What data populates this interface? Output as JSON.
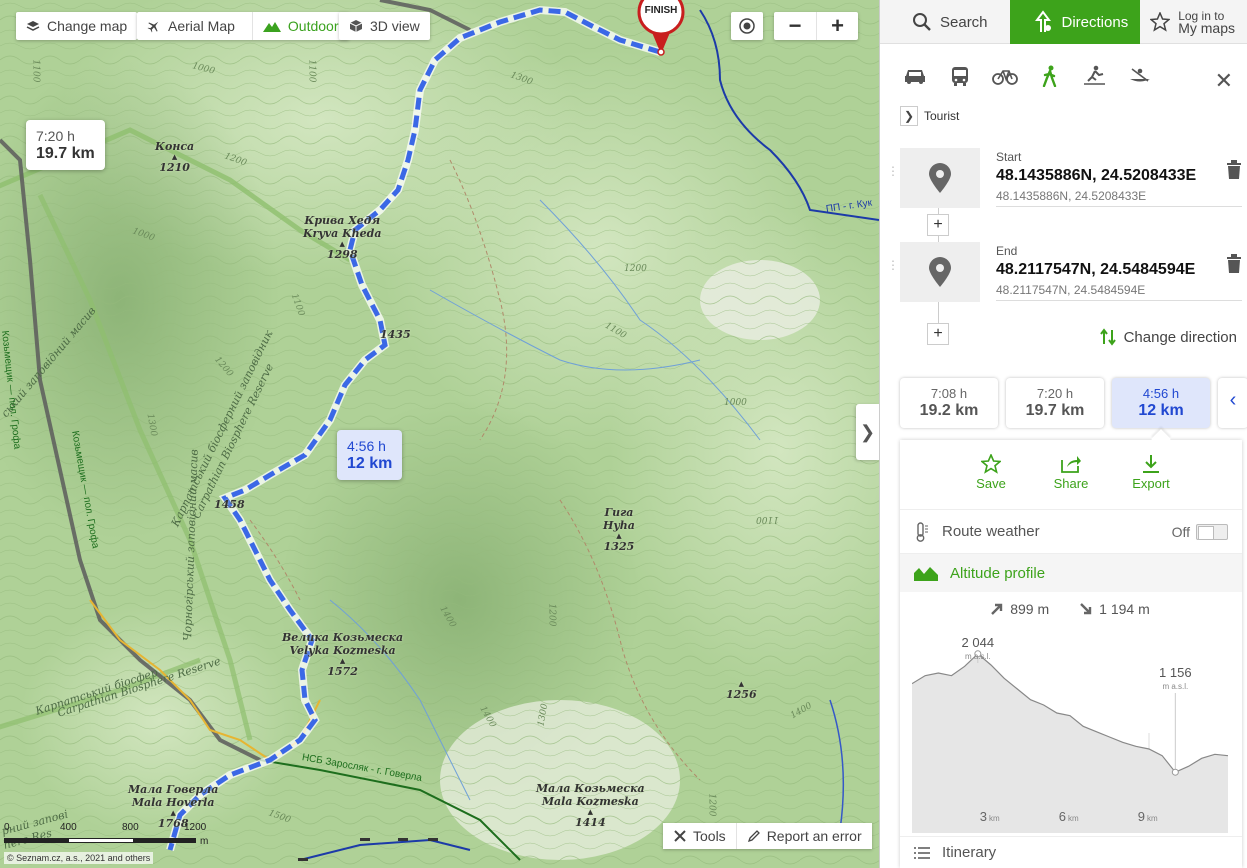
{
  "map_controls": {
    "change_map": "Change map",
    "aerial_map": "Aerial Map",
    "outdoor": "Outdoor",
    "view3d": "3D view",
    "zoom_out": "−",
    "zoom_in": "+",
    "tools": "Tools",
    "report_error": "Report an error"
  },
  "map": {
    "finish_label": "FINISH",
    "bubbles": [
      {
        "time": "7:20 h",
        "distance": "19.7 km"
      },
      {
        "time": "4:56 h",
        "distance": "12 km"
      }
    ],
    "peaks": [
      {
        "name": "Конса",
        "elev": "1210"
      },
      {
        "name": "Крива Хедя",
        "name2": "Kryva Kheda",
        "elev": "1298"
      },
      {
        "name": "Гига",
        "name2": "Hyha",
        "elev": "1325"
      },
      {
        "name": "Велика Козьмеска",
        "name2": "Velyka Kozmeska",
        "elev": "1572"
      },
      {
        "name": "Мала Говерла",
        "name2": "Mala Hoverla",
        "elev": "1768"
      },
      {
        "name": "Мала Козьмеска",
        "name2": "Mala Kozmeska",
        "elev": "1414"
      },
      {
        "elev": "1256"
      },
      {
        "elev": "1435"
      },
      {
        "elev": "1458"
      }
    ],
    "contours": [
      "1100",
      "1000",
      "1300",
      "1200",
      "1000",
      "1100",
      "1200",
      "1200",
      "1300",
      "1000",
      "1100",
      "1100",
      "1200",
      "1400",
      "1300",
      "1200",
      "1400",
      "1100",
      "1500",
      "1400"
    ],
    "roads": {
      "road1": "ПП - г. Кук",
      "road2": "НСБ Заросляк - г. Говерла",
      "trail1": "Козьмещик — пол. Грофа",
      "trail2": "Козьмещик — пол. Грофа"
    },
    "reserves": {
      "r1": "Карпатський біосферний заповідник",
      "r1en": "Carpathian Biosphere Reserve",
      "r2": "Карпатський біосфер",
      "r2en": "Carpathian Biosphere Reserve",
      "r3": "Чорногірський заповідний масив",
      "r4": "ський заповідний масив",
      "r5": "рний запові",
      "r5en": "here Res"
    },
    "scale": [
      "0",
      "400",
      "800",
      "1200",
      "m"
    ],
    "copyright": "© Seznam.cz, a.s., 2021 and others"
  },
  "panel": {
    "tabs": {
      "search": "Search",
      "directions": "Directions",
      "login1": "Log in to",
      "login2": "My maps"
    },
    "profile": "Tourist",
    "start": {
      "label": "Start",
      "value": "48.1435886N, 24.5208433E",
      "sub": "48.1435886N, 24.5208433E"
    },
    "end": {
      "label": "End",
      "value": "48.2117547N, 24.5484594E",
      "sub": "48.2117547N, 24.5484594E"
    },
    "change_direction": "Change direction",
    "alternatives": [
      {
        "time": "7:08 h",
        "distance": "19.2 km"
      },
      {
        "time": "7:20 h",
        "distance": "19.7 km"
      },
      {
        "time": "4:56 h",
        "distance": "12 km"
      }
    ],
    "actions": {
      "save": "Save",
      "share": "Share",
      "export": "Export"
    },
    "route_weather": "Route weather",
    "weather_state": "Off",
    "altitude_profile": "Altitude profile",
    "ascent": "899 m",
    "descent": "1 194 m",
    "itinerary": "Itinerary"
  },
  "chart_data": {
    "type": "area",
    "title": "Altitude profile",
    "xlabel": "km",
    "ylabel": "m a.s.l.",
    "x_ticks": [
      "3",
      "6",
      "9"
    ],
    "x": [
      0,
      0.5,
      1,
      1.5,
      2,
      2.5,
      3,
      3.5,
      4,
      4.5,
      5,
      5.5,
      6,
      6.5,
      7,
      7.5,
      8,
      8.5,
      9,
      9.5,
      10,
      10.5,
      11,
      11.5,
      12
    ],
    "y": [
      1820,
      1880,
      1900,
      1880,
      1950,
      2044,
      1960,
      1860,
      1780,
      1700,
      1660,
      1600,
      1580,
      1500,
      1460,
      1420,
      1380,
      1350,
      1330,
      1280,
      1156,
      1200,
      1260,
      1290,
      1280
    ],
    "annotations": [
      {
        "value": "2 044",
        "unit": "m a.s.l.",
        "x": 2.5
      },
      {
        "value": "1 156",
        "unit": "m a.s.l.",
        "x": 10
      }
    ],
    "ylim": [
      700,
      2200
    ]
  }
}
